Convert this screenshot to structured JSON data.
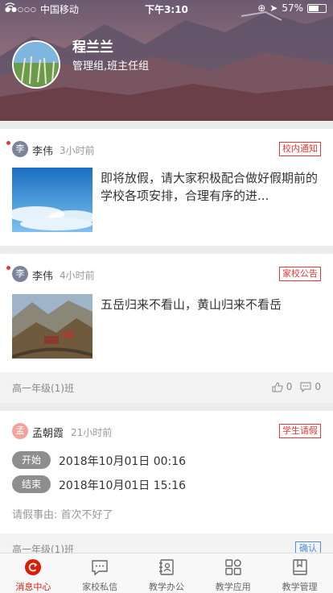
{
  "status_bar": {
    "carrier": "中国移动",
    "time": "下午3:10",
    "battery": "57%"
  },
  "profile": {
    "name": "程兰兰",
    "role": "管理组,班主任组"
  },
  "posts": [
    {
      "author_initial": "李",
      "author": "李伟",
      "time": "3小时前",
      "tag": "校内通知",
      "text": "即将放假，请大家积极配合做好假期前的学校各项安排，合理有序的进..."
    },
    {
      "author_initial": "李",
      "author": "李伟",
      "time": "4小时前",
      "tag": "家校公告",
      "text": "五岳归来不看山，黄山归来不看岳",
      "class_name": "高一年级(1)班",
      "likes": "0",
      "comments": "0"
    },
    {
      "author_initial": "孟",
      "author": "孟朝霞",
      "time": "21小时前",
      "tag": "学生请假",
      "start_label": "开始",
      "start": "2018年10月01日 00:16",
      "end_label": "结束",
      "end": "2018年10月01日 15:16",
      "reason": "请假事由: 首次不好了",
      "class_name": "高一年级(1)班",
      "confirm": "确认"
    }
  ],
  "tabs": [
    {
      "label": "消息中心",
      "icon": "message-center-icon",
      "active": true
    },
    {
      "label": "家校私信",
      "icon": "chat-bubble-icon"
    },
    {
      "label": "教学办公",
      "icon": "contacts-book-icon"
    },
    {
      "label": "教学应用",
      "icon": "apps-grid-icon"
    },
    {
      "label": "教学管理",
      "icon": "bookmark-book-icon"
    }
  ],
  "colors": {
    "accent": "#d81e06",
    "tag_red": "#e53935",
    "confirm_blue": "#4a90e2"
  }
}
